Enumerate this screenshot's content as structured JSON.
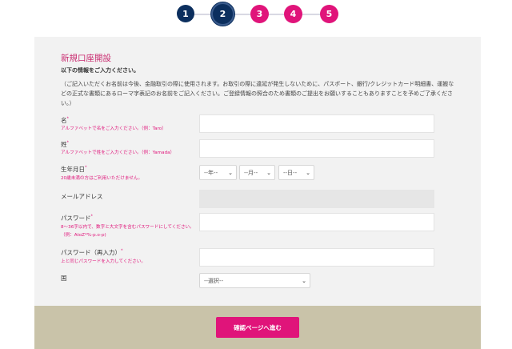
{
  "steps": [
    {
      "label": "1",
      "state": "done"
    },
    {
      "label": "2",
      "state": "current"
    },
    {
      "label": "3",
      "state": "todo"
    },
    {
      "label": "4",
      "state": "todo"
    },
    {
      "label": "5",
      "state": "todo"
    }
  ],
  "form": {
    "title": "新規口座開設",
    "lead": "以下の情報をご入力ください。",
    "note": "（ご記入いただくお名前は今後、金融取引の際に使用されます。お取引の際に違延が発生しないために、パスポート、銀行/クレジットカード明細書、運搬などの正式な書類にあるローマ字表記のお名前をご記入ください。ご登録情報の照合のため書類のご提出をお願いすることもありますことを予めご了承ください。）",
    "first_name": {
      "label": "名",
      "hint": "アルファベットで名をご入力ください。（例：Taro）",
      "value": ""
    },
    "last_name": {
      "label": "姓",
      "hint": "アルファベットで姓をご入力ください。（例：Yamada）",
      "value": ""
    },
    "birthdate": {
      "label": "生年月日",
      "hint": "20歳未満の方はご利用いただけません。",
      "year": "--年--",
      "month": "--月--",
      "day": "--日--"
    },
    "email": {
      "label": "メールアドレス",
      "value": ""
    },
    "password": {
      "label": "パスワード",
      "hint": "8〜36字以内で、数字と大文字を含むパスワードにしてください。（例：AtoZ*%-p.o-p)",
      "value": ""
    },
    "password_confirm": {
      "label": "パスワード（再入力）",
      "hint": "上と同じパスワードを入力してください。",
      "value": ""
    },
    "country": {
      "label": "国",
      "selected": "--選択--"
    }
  },
  "footer": {
    "confirm_label": "確認ページへ進む"
  },
  "colors": {
    "navy": "#0c2f5e",
    "accent": "#e0147a",
    "footer": "#c9c3a9"
  }
}
